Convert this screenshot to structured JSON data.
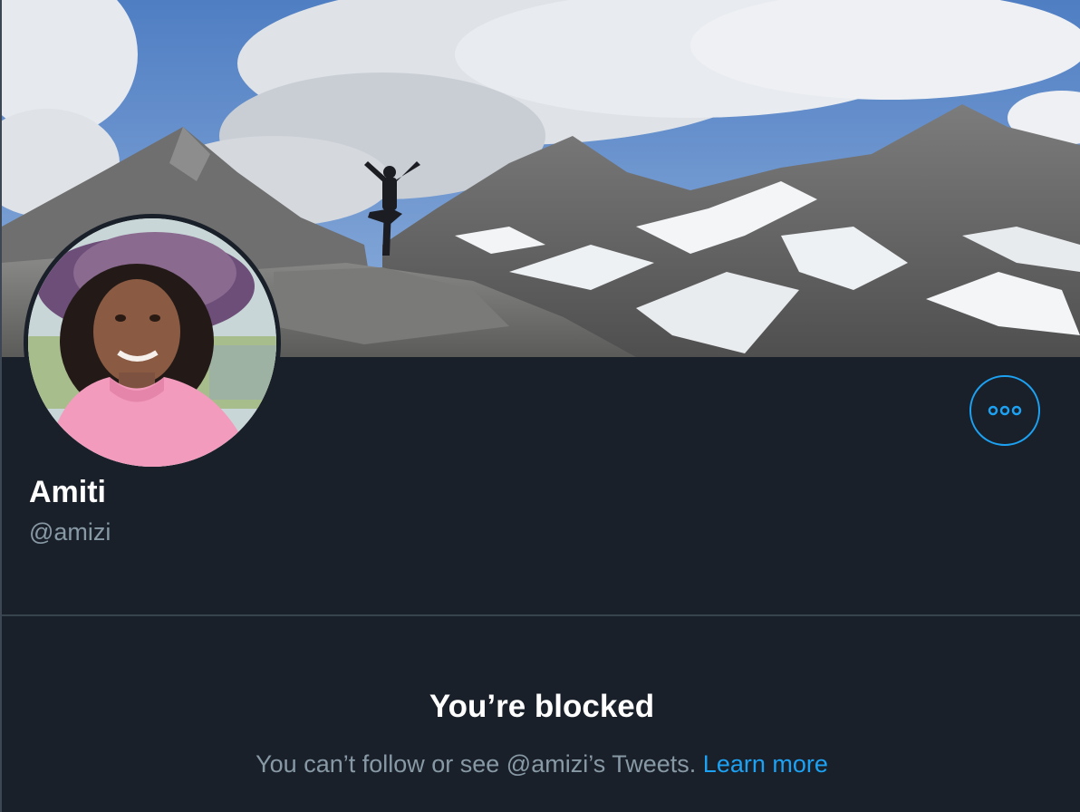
{
  "profile": {
    "display_name": "Amiti",
    "handle": "@amizi",
    "banner_image": "mountain-landscape-banner",
    "avatar_image": "profile-photo"
  },
  "actions": {
    "more_icon": "more-horizontal-icon"
  },
  "blocked": {
    "title": "You’re blocked",
    "message": "You can’t follow or see @amizi’s Tweets.",
    "link_label": "Learn more"
  },
  "colors": {
    "background": "#192029",
    "accent": "#1da1f2",
    "secondary_text": "#8899a6",
    "primary_text": "#ffffff"
  }
}
